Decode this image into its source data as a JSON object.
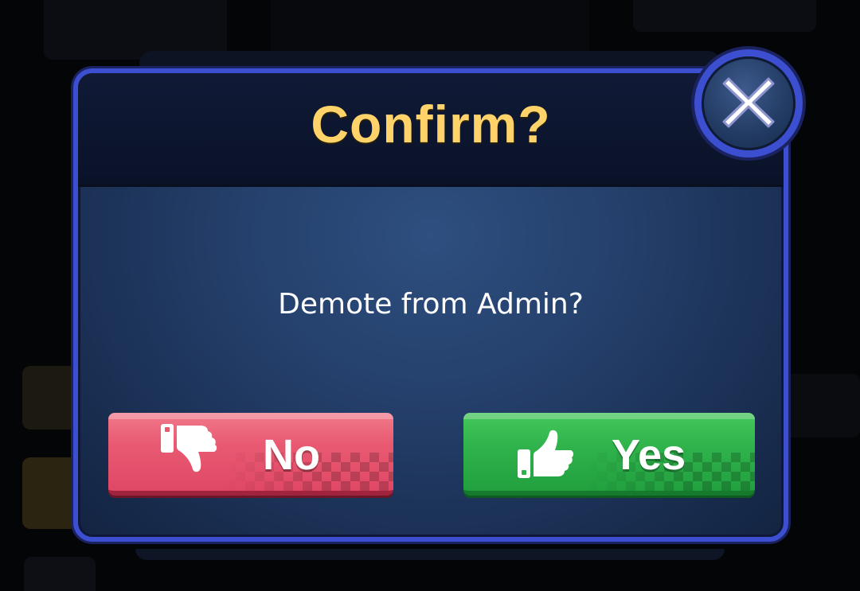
{
  "dialog": {
    "title": "Confirm?",
    "message": "Demote from Admin?"
  },
  "buttons": {
    "no_label": "No",
    "yes_label": "Yes",
    "no_icon": "thumbs-down-icon",
    "yes_icon": "thumbs-up-icon",
    "close_icon": "close-icon"
  },
  "colors": {
    "title": "#ffd36a",
    "frame": "#3c4fd0",
    "no_button": "#e95a72",
    "yes_button": "#2fb24b"
  }
}
